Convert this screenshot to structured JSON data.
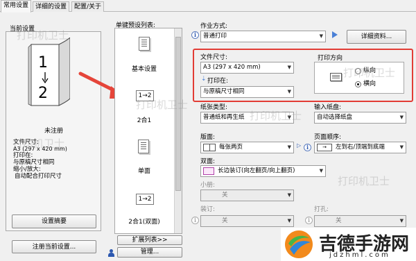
{
  "tabs": [
    "常用设置",
    "详细的设置",
    "配置/关于"
  ],
  "current": {
    "title": "当前设置",
    "preview_numbers": [
      "1",
      "2"
    ],
    "status": "未注册",
    "details": [
      "文件尺寸:",
      "A3 (297 x 420 mm)",
      "打印在:",
      "与原稿尺寸相同",
      "缩小/放大:",
      "自动配合打印尺寸"
    ],
    "settings_button": "设置摘要",
    "register_button": "注册当前设置..."
  },
  "presets": {
    "title": "单键预设列表:",
    "items": [
      {
        "label": "基本设置",
        "glyph": ""
      },
      {
        "label": "2合1",
        "glyph": "1→2"
      },
      {
        "label": "单面",
        "glyph": ""
      },
      {
        "label": "2合1(双面)",
        "glyph": "1→2"
      }
    ],
    "expand_button": "扩展列表>>",
    "manage_button": "管理..."
  },
  "form": {
    "job_label": "作业方式:",
    "job_value": "普通打印",
    "details_button": "详细资料...",
    "size_label": "文件尺寸:",
    "size_value": "A3 (297 x 420 mm)",
    "print_on_label": "打印在:",
    "print_on_value": "与原稿尺寸相同",
    "orientation_title": "打印方向",
    "orientation_options": [
      "纵向",
      "横向"
    ],
    "paper_type_label": "纸张类型:",
    "paper_type_value": "普通纸和再生纸",
    "input_tray_label": "输入纸盘:",
    "input_tray_value": "自动选择纸盘",
    "layout_label": "版面:",
    "layout_value": "每张两页",
    "page_order_label": "页面顺序:",
    "page_order_value": "左到右/顶端到底端",
    "duplex_label": "双面:",
    "duplex_value": "长边装订(向左翻页/向上翻页)",
    "booklet_label": "小册:",
    "booklet_value": "关",
    "staple_label": "装订:",
    "staple_value": "关",
    "punch_label": "打孔:",
    "punch_value": "关"
  },
  "watermarks": [
    "打印机卫士",
    "打印机卫士",
    "打印机卫士",
    "打印机卫士",
    "打印机卫士",
    "打印机卫士"
  ],
  "site_logo": {
    "name": "吉德手游网",
    "url": "jdzhml.com"
  },
  "colors": {
    "highlight": "#e23c35",
    "arrow": "#e5453a",
    "accent": "#2c58b0"
  }
}
